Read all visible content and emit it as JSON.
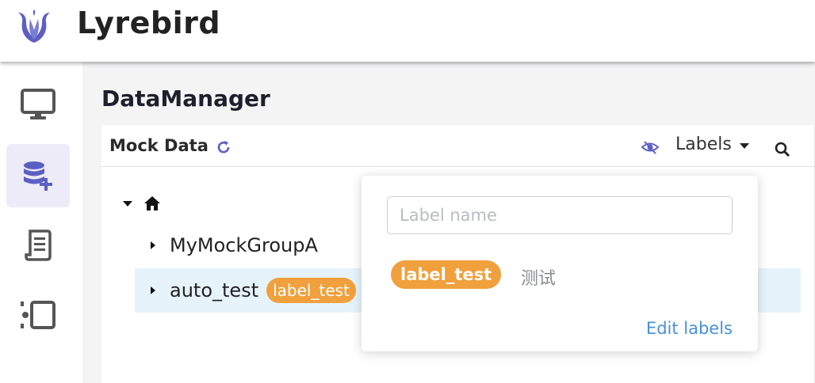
{
  "app": {
    "title": "Lyrebird",
    "logo_icon": "lyrebird-logo",
    "accent": "#6264c7"
  },
  "sidebar": {
    "items": [
      {
        "icon": "monitor-icon",
        "active": false
      },
      {
        "icon": "database-add-icon",
        "active": true
      },
      {
        "icon": "scroll-icon",
        "active": false
      },
      {
        "icon": "checkpoint-icon",
        "active": false
      }
    ]
  },
  "page": {
    "title": "DataManager"
  },
  "panel": {
    "title": "Mock Data",
    "refresh_icon": "refresh-icon",
    "eye_icon": "eye-off-icon",
    "labels_dropdown": "Labels",
    "search_icon": "search-icon"
  },
  "tree": {
    "root_icon": "home-icon",
    "nodes": [
      {
        "name": "MyMockGroupA",
        "tag": ""
      },
      {
        "name": "auto_test",
        "tag": "label_test"
      }
    ]
  },
  "popover": {
    "input_placeholder": "Label name",
    "input_value": "",
    "labels": [
      "label_test",
      "测试"
    ],
    "edit_link": "Edit labels",
    "tag_color": "#f0a03c",
    "link_color": "#4a90d9"
  }
}
